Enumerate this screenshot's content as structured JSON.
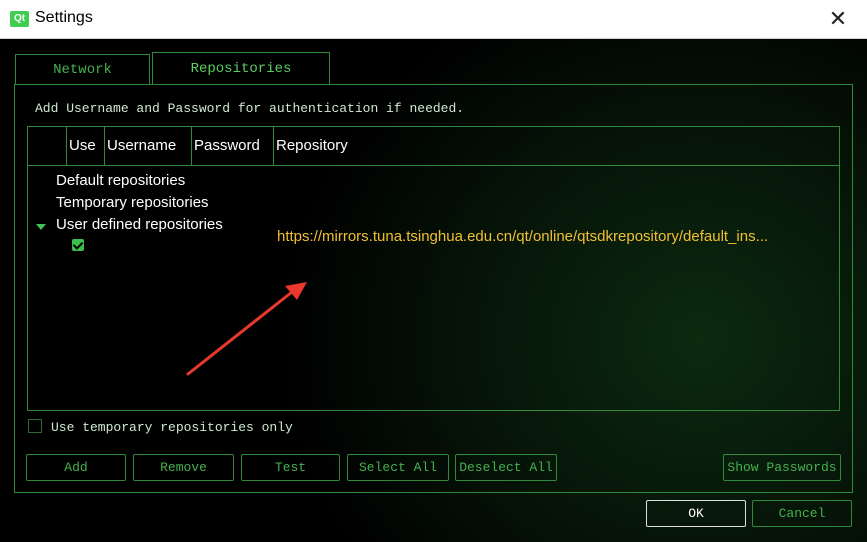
{
  "window": {
    "title": "Settings",
    "logo_text": "Qt",
    "close_glyph": "✕"
  },
  "tabs": [
    {
      "label": "Network",
      "active": false
    },
    {
      "label": "Repositories",
      "active": true
    }
  ],
  "repositories": {
    "hint": "Add Username and Password for authentication if needed.",
    "columns": [
      "",
      "Use",
      "Username",
      "Password",
      "Repository"
    ],
    "groups": [
      {
        "label": "Default repositories",
        "expanded": false
      },
      {
        "label": "Temporary repositories",
        "expanded": false
      },
      {
        "label": "User defined repositories",
        "expanded": true
      }
    ],
    "user_entry": {
      "use_checked": true,
      "repository": "https://mirrors.tuna.tsinghua.edu.cn/qt/online/qtsdkrepository/default_ins..."
    },
    "temp_only_label": "Use temporary repositories only",
    "temp_only_checked": false,
    "buttons": {
      "add": "Add",
      "remove": "Remove",
      "test": "Test",
      "select_all": "Select All",
      "deselect_all": "Deselect All",
      "show_passwords": "Show Passwords"
    }
  },
  "dialog_buttons": {
    "ok": "OK",
    "cancel": "Cancel"
  },
  "colors": {
    "accent_green": "#46b04e",
    "border_green": "#2f8a3a",
    "url_yellow": "#f0c030",
    "arrow_red": "#e8392c"
  }
}
